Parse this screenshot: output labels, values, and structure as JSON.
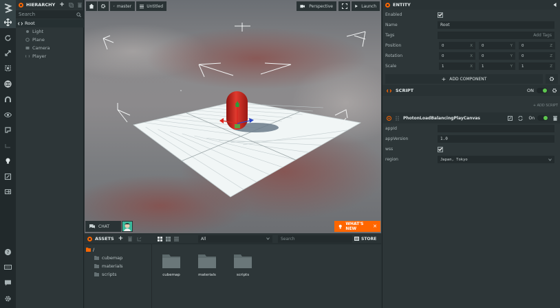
{
  "toolbar": {
    "tools": [
      "translate",
      "rotate",
      "scale",
      "resize",
      "world",
      "magnet",
      "focus",
      "record",
      "link",
      "light",
      "edit",
      "export"
    ],
    "bottom": [
      "help",
      "keyboard",
      "chat",
      "settings"
    ]
  },
  "hierarchy": {
    "title": "HIERARCHY",
    "search_placeholder": "Search",
    "root": "Root",
    "children": [
      "Light",
      "Plane",
      "Camera",
      "Player"
    ]
  },
  "viewport": {
    "branch": "master",
    "scene": "Untitled",
    "camera": "Perspective",
    "launch": "Launch",
    "chat": "CHAT",
    "whats_new": "WHAT'S NEW"
  },
  "assets": {
    "title": "ASSETS",
    "filter": "All",
    "search_placeholder": "Search",
    "store": "STORE",
    "root_path": "/",
    "tree": [
      "cubemap",
      "materials",
      "scripts"
    ],
    "folders": [
      "cubemap",
      "materials",
      "scripts"
    ]
  },
  "inspector": {
    "title": "ENTITY",
    "enabled_label": "Enabled",
    "enabled": true,
    "name_label": "Name",
    "name_value": "Root",
    "tags_label": "Tags",
    "add_tags": "Add Tags",
    "position_label": "Position",
    "position": [
      "0",
      "0",
      "0"
    ],
    "rotation_label": "Rotation",
    "rotation": [
      "0",
      "0",
      "0"
    ],
    "scale_label": "Scale",
    "scale": [
      "1",
      "1",
      "1"
    ],
    "axes": [
      "X",
      "Y",
      "Z"
    ],
    "add_component": "ADD COMPONENT",
    "script_section": "SCRIPT",
    "script_on": "ON",
    "add_script": "+ ADD SCRIPT",
    "script_name": "PhotonLoadBalancingPlayCanvas",
    "script_toggle": "On",
    "attrs": {
      "appid_label": "appId",
      "appid_value": "",
      "appversion_label": "appVersion",
      "appversion_value": "1.0",
      "wss_label": "wss",
      "wss_checked": true,
      "region_label": "region",
      "region_value": "Japan, Tokyo"
    }
  },
  "colors": {
    "accent": "#ff6600",
    "toggle_on": "#5ec74f",
    "panel_bg": "#2d3638",
    "toolbar_bg": "#21292b"
  }
}
